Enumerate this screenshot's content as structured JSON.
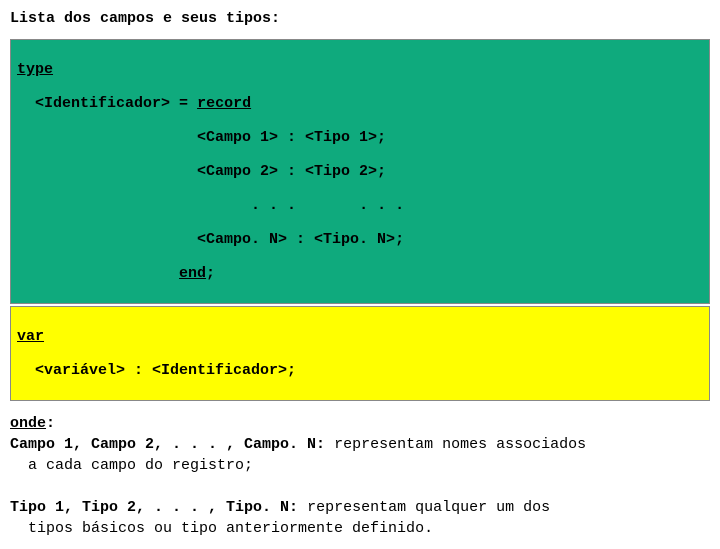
{
  "heading": "Lista dos campos e seus tipos:",
  "green": {
    "kw_type": "type",
    "ident": "<Identificador>",
    "eq": " = ",
    "kw_record": "record",
    "indent_rec": "  ",
    "indent_field": "                    ",
    "indent_dots": "                          ",
    "field1": "<Campo 1> : <Tipo 1>;",
    "field2": "<Campo 2> : <Tipo 2>;",
    "dots": ". . .       . . .",
    "fieldN": "<Campo. N> : <Tipo. N>;",
    "indent_end": "                  ",
    "kw_end": "end",
    "semi": ";"
  },
  "yellow": {
    "kw_var": "var",
    "indent": "  ",
    "line": "<variável> : <Identificador>;"
  },
  "explain": {
    "kw_onde": "onde",
    "colon": ":",
    "campo_line": "Campo 1, Campo 2, . . . , Campo. N: ",
    "campo_rest": "representam nomes associados",
    "campo_cont": "a cada campo do registro;",
    "tipo_line": "Tipo 1, Tipo 2, . . . , Tipo. N: ",
    "tipo_rest": "representam qualquer um dos",
    "tipo_cont": "tipos básicos ou tipo anteriormente definido."
  }
}
